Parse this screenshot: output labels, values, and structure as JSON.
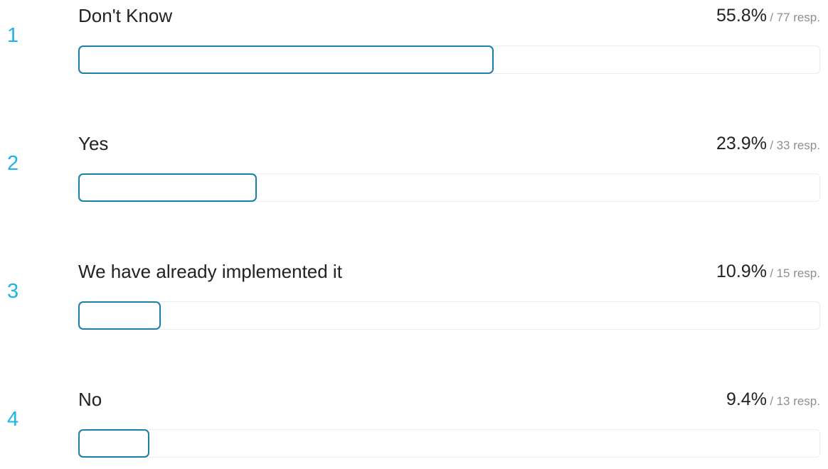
{
  "chart_data": {
    "type": "bar",
    "orientation": "horizontal",
    "categories": [
      "Don't Know",
      "Yes",
      "We have already implemented it",
      "No"
    ],
    "ranks": [
      "1",
      "2",
      "3",
      "4"
    ],
    "values": [
      55.8,
      23.9,
      10.9,
      9.4
    ],
    "value_labels": [
      "55.8%",
      "23.9%",
      "10.9%",
      "9.4%"
    ],
    "responses": [
      77,
      33,
      15,
      13
    ],
    "response_labels": [
      "77 resp.",
      "33 resp.",
      "15 resp.",
      "13 resp."
    ],
    "separator": "/",
    "xlim": [
      0,
      100
    ],
    "colors": {
      "rank": "#1eb4e6",
      "bar_outline": "#1b7faa",
      "track": "#e4eff3",
      "label": "#222222",
      "secondary": "#8a8f93"
    }
  }
}
